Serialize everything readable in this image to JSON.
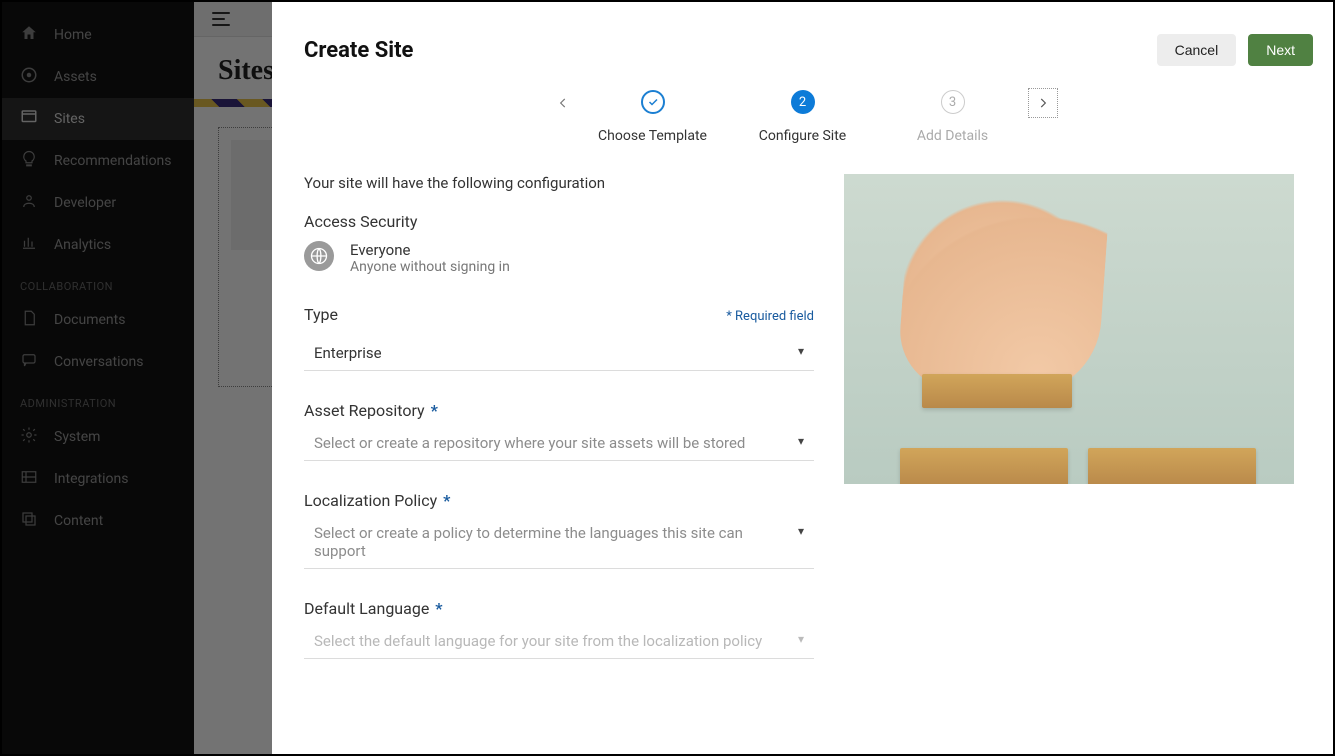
{
  "sidebar": {
    "items": [
      {
        "label": "Home"
      },
      {
        "label": "Assets"
      },
      {
        "label": "Sites"
      },
      {
        "label": "Recommendations"
      },
      {
        "label": "Developer"
      },
      {
        "label": "Analytics"
      }
    ],
    "section_collab": "COLLABORATION",
    "collab_items": [
      {
        "label": "Documents"
      },
      {
        "label": "Conversations"
      }
    ],
    "section_admin": "ADMINISTRATION",
    "admin_items": [
      {
        "label": "System"
      },
      {
        "label": "Integrations"
      },
      {
        "label": "Content"
      }
    ]
  },
  "page": {
    "title": "Sites"
  },
  "modal": {
    "title": "Create Site",
    "cancel": "Cancel",
    "next": "Next",
    "steps": {
      "choose": "Choose Template",
      "configure": "Configure Site",
      "add": "Add Details",
      "add_num": "3"
    },
    "config_intro": "Your site will have the following configuration",
    "access": {
      "heading": "Access Security",
      "main": "Everyone",
      "sub": "Anyone without signing in"
    },
    "required_note": "* Required field",
    "type": {
      "label": "Type",
      "value": "Enterprise"
    },
    "repo": {
      "label": "Asset Repository",
      "placeholder": "Select or create a repository where your site assets will be stored"
    },
    "loc": {
      "label": "Localization Policy",
      "placeholder": "Select or create a policy to determine the languages this site can support"
    },
    "lang": {
      "label": "Default Language",
      "placeholder": "Select the default language for your site from the localization policy"
    }
  }
}
